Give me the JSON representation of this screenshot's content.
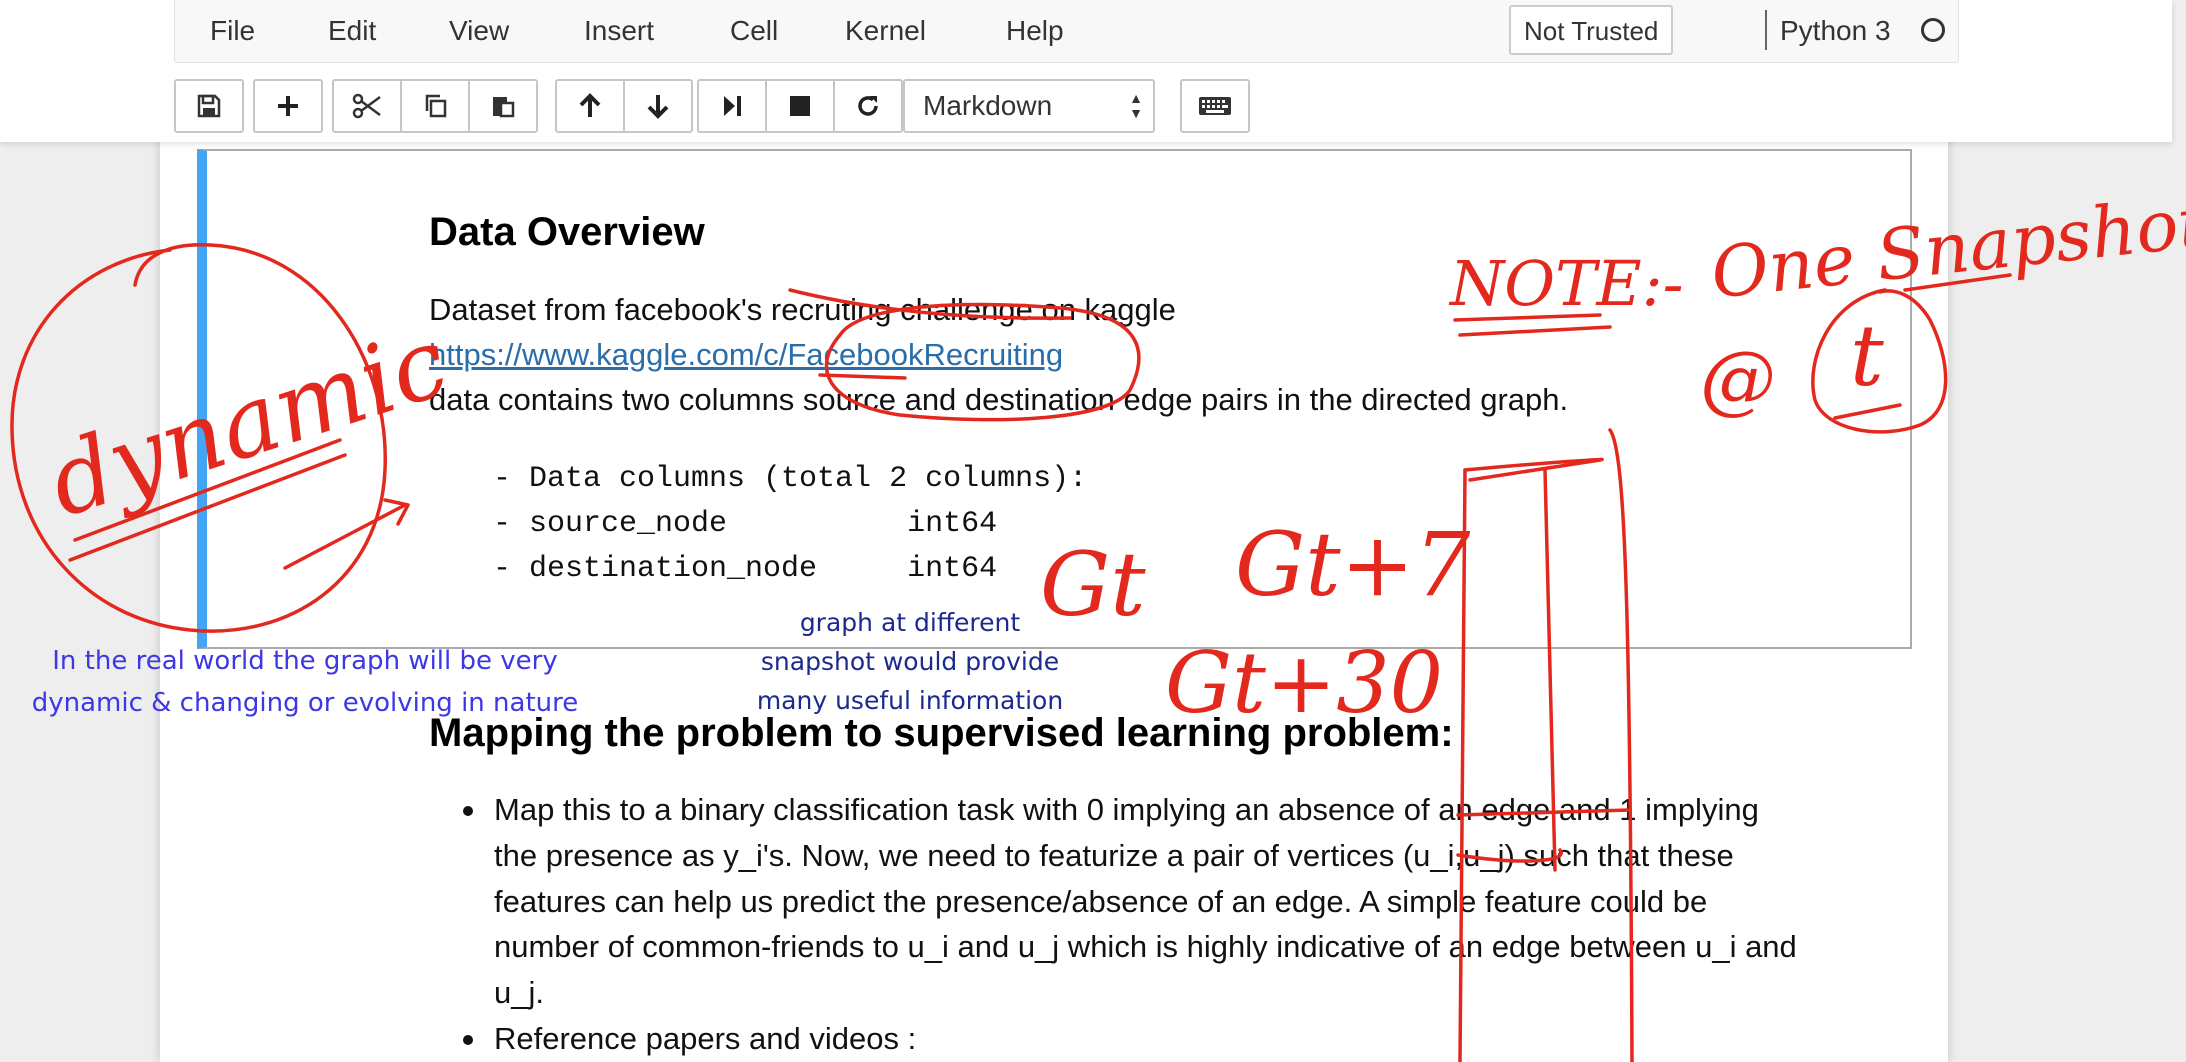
{
  "menu": {
    "items": [
      "File",
      "Edit",
      "View",
      "Insert",
      "Cell",
      "Kernel",
      "Help"
    ],
    "trust_label": "Not Trusted",
    "kernel_name": "Python 3"
  },
  "toolbar": {
    "icons": [
      "save-icon",
      "plus-icon",
      "scissors-icon",
      "copy-icon",
      "paste-icon",
      "arrow-up-icon",
      "arrow-down-icon",
      "run-icon",
      "stop-icon",
      "restart-icon",
      "keyboard-icon"
    ],
    "cell_type": "Markdown"
  },
  "cell1": {
    "heading": "Data Overview",
    "line1": "Dataset from facebook's recruting challenge on kaggle",
    "link": "https://www.kaggle.com/c/FacebookRecruiting",
    "line3": "data contains two columns source and destination edge pairs in the directed graph.",
    "code": [
      "- Data columns (total 2 columns):",
      "- source_node          int64",
      "- destination_node     int64"
    ]
  },
  "cell2": {
    "heading": "Mapping the problem to supervised learning problem:",
    "bullet1_lines": [
      "Map this to a binary classification task with 0 implying an absence of an edge and 1 implying",
      "the presence as y_i's. Now, we need to featurize a pair of vertices (u_i,u_j) such that these",
      "features can help us predict the presence/absence of an edge. A simple feature could be",
      "number of common-friends to u_i and u_j which is highly indicative of an edge between u_i and",
      "u_j."
    ],
    "bullet2": "Reference papers and videos :"
  },
  "annotations": {
    "dynamic": "dynamic",
    "note_title": "NOTE:-",
    "note_body": "One Snapshot",
    "at_symbol": "@",
    "t_symbol": "t",
    "g_labels": [
      "Gt",
      "Gt+7",
      "Gt+30"
    ],
    "left_note": [
      "In the real world the graph will be very",
      "dynamic & changing or evolving in nature"
    ],
    "center_note": [
      "graph at different",
      "snapshot would provide",
      "many useful information"
    ]
  },
  "colors": {
    "ink_red": "#e3281e",
    "ink_blue": "#3d37e6",
    "ink_navy": "#1b2a8e",
    "cell_selected_bar": "#42a5f5",
    "link": "#296eaa"
  }
}
